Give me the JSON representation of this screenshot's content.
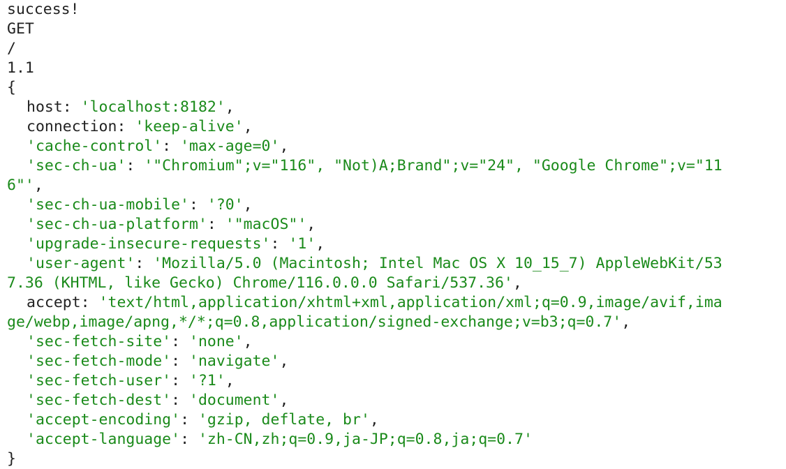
{
  "status": "success!",
  "method": "GET",
  "path": "/",
  "version": "1.1",
  "open_brace": "{",
  "close_brace": "}",
  "colors": {
    "key": "#222222",
    "string": "#1a8a1a"
  },
  "headers": [
    {
      "key": "host",
      "value": "'localhost:8182'",
      "sep": ": ",
      "end": ","
    },
    {
      "key": "connection",
      "value": "'keep-alive'",
      "sep": ": ",
      "end": ","
    },
    {
      "key": "'cache-control'",
      "value": "'max-age=0'",
      "sep": ": ",
      "end": ","
    },
    {
      "key": "'sec-ch-ua'",
      "value_line1": "'\"Chromium\";v=\"116\", \"Not)A;Brand\";v=\"24\", \"Google Chrome\";v=\"11",
      "value_line2": "6\"'",
      "sep": ": ",
      "end": ","
    },
    {
      "key": "'sec-ch-ua-mobile'",
      "value": "'?0'",
      "sep": ": ",
      "end": ","
    },
    {
      "key": "'sec-ch-ua-platform'",
      "value": "'\"macOS\"'",
      "sep": ": ",
      "end": ","
    },
    {
      "key": "'upgrade-insecure-requests'",
      "value": "'1'",
      "sep": ": ",
      "end": ","
    },
    {
      "key": "'user-agent'",
      "value_line1": "'Mozilla/5.0 (Macintosh; Intel Mac OS X 10_15_7) AppleWebKit/53",
      "value_line2": "7.36 (KHTML, like Gecko) Chrome/116.0.0.0 Safari/537.36'",
      "sep": ": ",
      "end": ","
    },
    {
      "key": "accept",
      "value_line1": "'text/html,application/xhtml+xml,application/xml;q=0.9,image/avif,ima",
      "value_line2": "ge/webp,image/apng,*/*;q=0.8,application/signed-exchange;v=b3;q=0.7'",
      "sep": ": ",
      "end": ","
    },
    {
      "key": "'sec-fetch-site'",
      "value": "'none'",
      "sep": ": ",
      "end": ","
    },
    {
      "key": "'sec-fetch-mode'",
      "value": "'navigate'",
      "sep": ": ",
      "end": ","
    },
    {
      "key": "'sec-fetch-user'",
      "value": "'?1'",
      "sep": ": ",
      "end": ","
    },
    {
      "key": "'sec-fetch-dest'",
      "value": "'document'",
      "sep": ": ",
      "end": ","
    },
    {
      "key": "'accept-encoding'",
      "value": "'gzip, deflate, br'",
      "sep": ": ",
      "end": ","
    },
    {
      "key": "'accept-language'",
      "value": "'zh-CN,zh;q=0.9,ja-JP;q=0.8,ja;q=0.7'",
      "sep": ": ",
      "end": ""
    }
  ]
}
